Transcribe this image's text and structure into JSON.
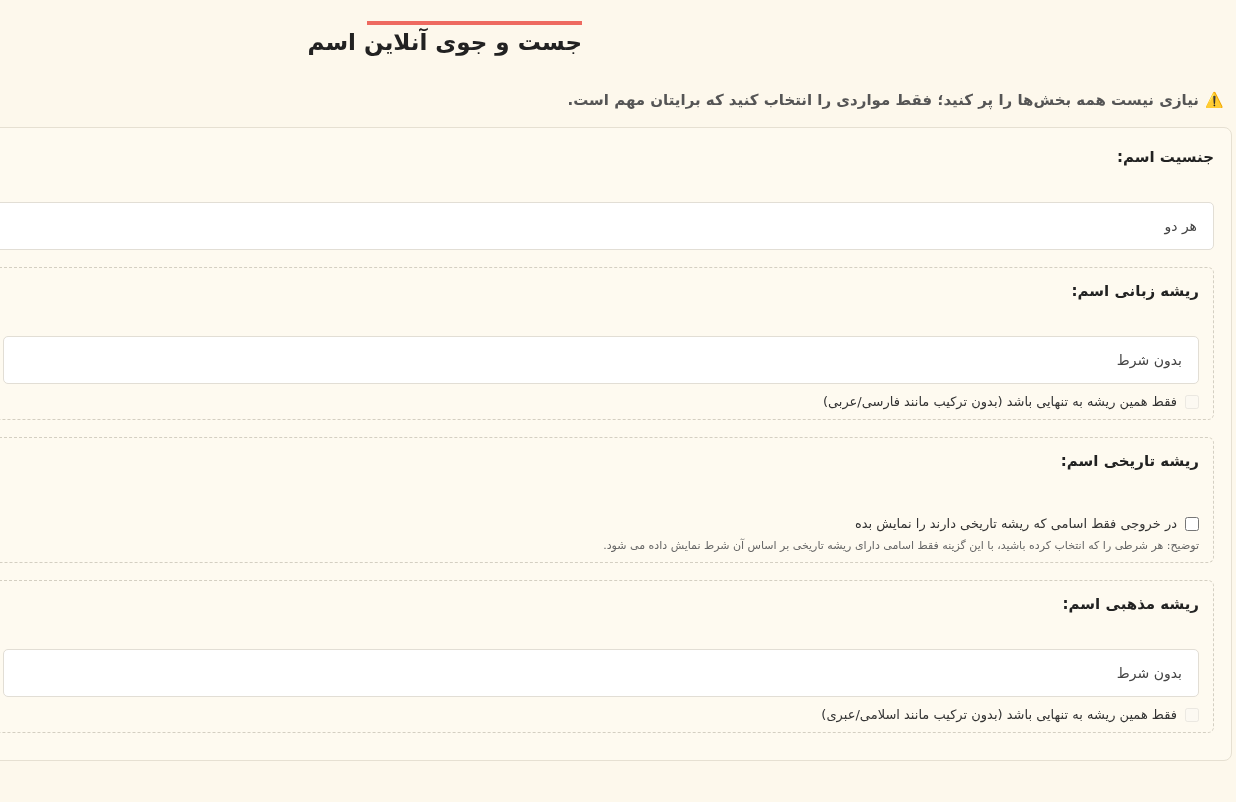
{
  "title": "جست و جوی آنلاین اسم",
  "notice": {
    "icon": "⚠️",
    "text": "نیازی نیست همه بخش‌ها را پر کنید؛ فقط مواردی را انتخاب کنید که برایتان مهم است."
  },
  "sections": [
    {
      "label": "جنسیت اسم:",
      "framed": false,
      "fields": [
        {
          "kind": "select",
          "value": "هر دو"
        }
      ]
    },
    {
      "label": "ریشه زبانی اسم:",
      "framed": true,
      "fields": [
        {
          "kind": "select",
          "value": "بدون شرط"
        },
        {
          "kind": "checkbox",
          "label": "فقط همین ریشه به تنهایی باشد (بدون ترکیب مانند فارسی/عربی)",
          "checked": false,
          "disabled": true
        }
      ]
    },
    {
      "label": "ریشه تاریخی اسم:",
      "framed": true,
      "fields": [
        {
          "kind": "checkbox",
          "label": "در خروجی فقط اسامی که ریشه تاریخی دارند را نمایش بده",
          "checked": false,
          "disabled": false
        },
        {
          "kind": "note",
          "text": "توضیح: هر شرطی را که انتخاب کرده باشید، با این گزینه فقط اسامی دارای ریشه تاریخی بر اساس آن شرط نمایش داده می شود."
        }
      ]
    },
    {
      "label": "ریشه مذهبی اسم:",
      "framed": true,
      "fields": [
        {
          "kind": "select",
          "value": "بدون شرط"
        },
        {
          "kind": "checkbox",
          "label": "فقط همین ریشه به تنهایی باشد (بدون ترکیب مانند اسلامی/عبری)",
          "checked": false,
          "disabled": true
        }
      ]
    }
  ]
}
